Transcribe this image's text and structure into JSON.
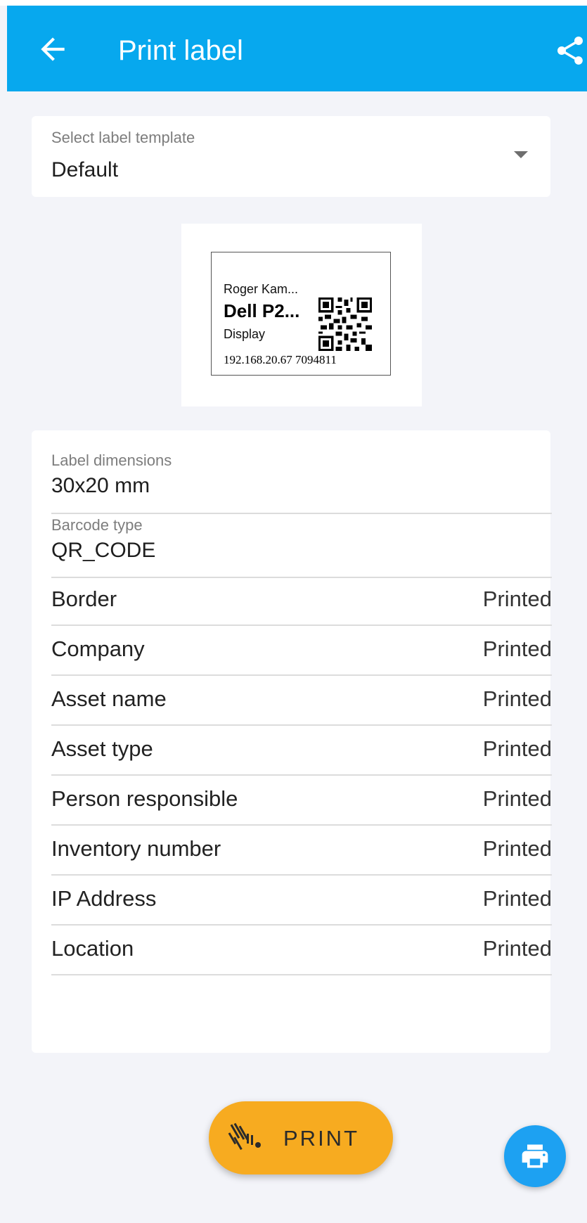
{
  "header": {
    "title": "Print label",
    "color": "#07a8ee"
  },
  "template_select": {
    "label": "Select label template",
    "value": "Default"
  },
  "label_preview": {
    "company": "Roger Kam...",
    "asset_name": "Dell P2...",
    "asset_type": "Display",
    "bottom_line": "192.168.20.67 7094811"
  },
  "properties": {
    "dimensions_label": "Label dimensions",
    "dimensions_value": "30x20 mm",
    "barcode_label": "Barcode type",
    "barcode_value": "QR_CODE",
    "rows": [
      {
        "name": "Border",
        "state": "Printed"
      },
      {
        "name": "Company",
        "state": "Printed"
      },
      {
        "name": "Asset name",
        "state": "Printed"
      },
      {
        "name": "Asset type",
        "state": "Printed"
      },
      {
        "name": "Person responsible",
        "state": "Printed"
      },
      {
        "name": "Inventory number",
        "state": "Printed"
      },
      {
        "name": "IP Address",
        "state": "Printed"
      },
      {
        "name": "Location",
        "state": "Printed"
      }
    ]
  },
  "actions": {
    "print_label": "PRINT",
    "print_color": "#f7ab20",
    "fab_color": "#1da1f2"
  },
  "icons": {
    "back": "arrow-left-icon",
    "share": "share-icon",
    "dropdown": "caret-down-icon",
    "print_button": "zebra-printer-icon",
    "fab": "printer-icon"
  }
}
